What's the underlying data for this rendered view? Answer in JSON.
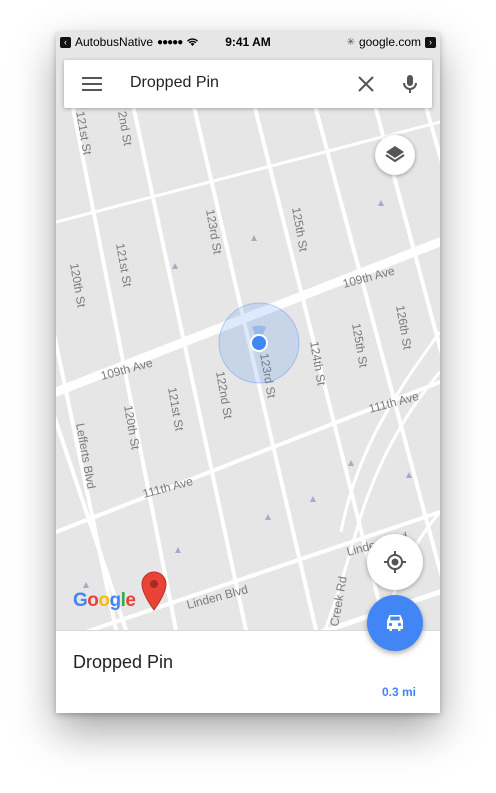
{
  "status_bar": {
    "carrier": "AutobusNative",
    "signal": "●●●●●",
    "time": "9:41 AM",
    "site": "google.com"
  },
  "search": {
    "query": "Dropped Pin"
  },
  "map": {
    "streets": [
      "121st St",
      "2nd St",
      "123rd St",
      "125th St",
      "120th St",
      "121st St",
      "109th Ave",
      "109th Ave",
      "123rd St",
      "124th St",
      "125th St",
      "126th St",
      "120th St",
      "121st St",
      "122nd St",
      "111th Ave",
      "Lefferts Blvd",
      "111th Ave",
      "Linden Blvd",
      "Linden Blvd",
      "Creek Rd"
    ],
    "colors": {
      "background": "#e6e6e6",
      "road": "#ffffff",
      "accent": "#4285f4",
      "pin": "#ea4335"
    }
  },
  "google_logo": {
    "letters": [
      "G",
      "o",
      "o",
      "g",
      "l",
      "e"
    ]
  },
  "bottom_sheet": {
    "title": "Dropped Pin",
    "distance": "0.3 mi"
  },
  "icons": {
    "back": "back-chevron-icon",
    "menu": "hamburger-menu-icon",
    "close": "close-icon",
    "mic": "microphone-icon",
    "layers": "layers-icon",
    "location": "my-location-icon",
    "directions": "car-icon",
    "pin": "map-pin-icon"
  }
}
